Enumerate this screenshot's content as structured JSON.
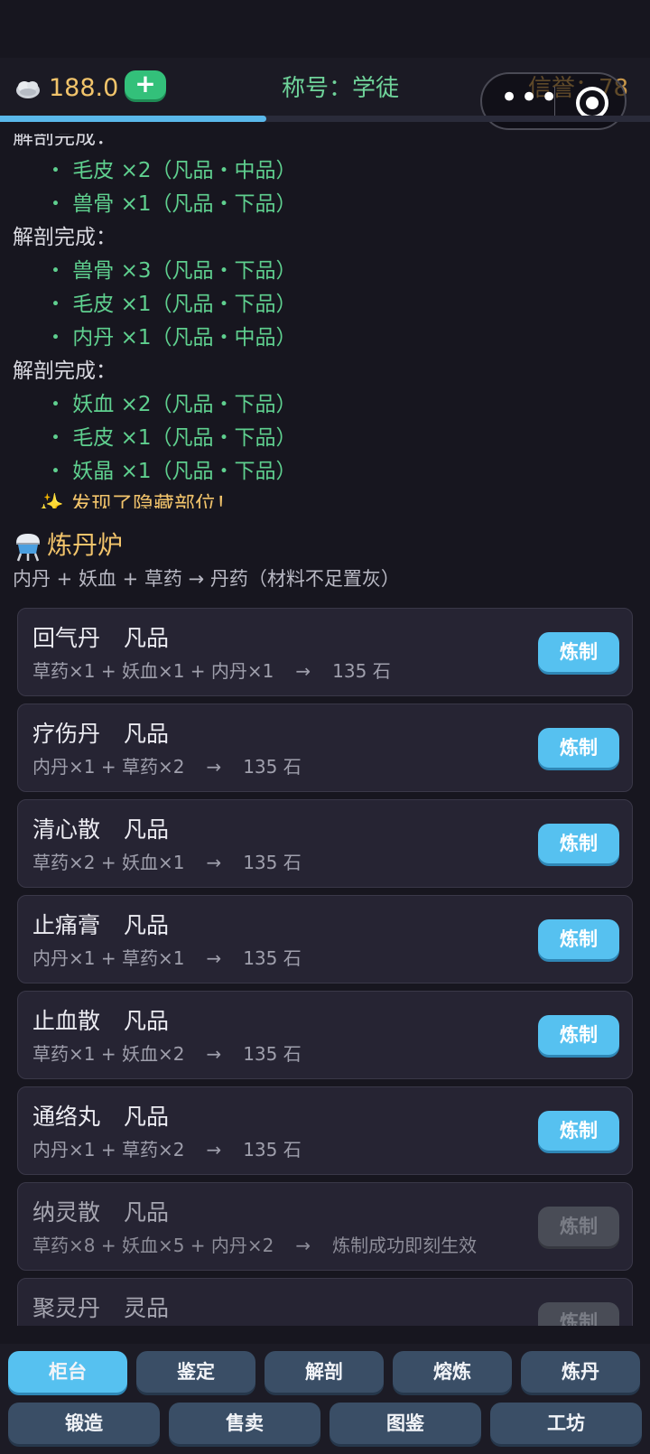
{
  "header": {
    "stone_icon": "spirit-stone-icon",
    "stone_value": "188.0",
    "plus_label": "+",
    "title_line": "称号：学徒",
    "credit_line": "信誉：78",
    "progress": 0.41
  },
  "capsule": {
    "more_label": "•••",
    "close_icon": "target-icon"
  },
  "log": [
    {
      "type": "head",
      "text": "解剖完成："
    },
    {
      "type": "item",
      "text": "・ 毛皮 ×2（凡品・中品）"
    },
    {
      "type": "item",
      "text": "・ 兽骨 ×1（凡品・下品）"
    },
    {
      "type": "head",
      "text": "解剖完成："
    },
    {
      "type": "item",
      "text": "・ 兽骨 ×3（凡品・下品）"
    },
    {
      "type": "item",
      "text": "・ 毛皮 ×1（凡品・下品）"
    },
    {
      "type": "item",
      "text": "・ 内丹 ×1（凡品・中品）"
    },
    {
      "type": "head",
      "text": "解剖完成："
    },
    {
      "type": "item",
      "text": "・ 妖血 ×2（凡品・下品）"
    },
    {
      "type": "item",
      "text": "・ 毛皮 ×1（凡品・下品）"
    },
    {
      "type": "item",
      "text": "・ 妖晶 ×1（凡品・下品）"
    },
    {
      "type": "bonus",
      "text": "✨ 发现了隐藏部位！"
    }
  ],
  "furnace": {
    "icon": "alchemy-flask-icon",
    "title": "炼丹炉",
    "subtitle": "内丹 + 妖血 + 草药 → 丹药（材料不足置灰）",
    "recipes": [
      {
        "name": "回气丹",
        "grade": "凡品",
        "inputs": "草药×1 + 妖血×1 + 内丹×1",
        "arrow": "→",
        "output": "135 石",
        "button": "炼制",
        "enabled": true
      },
      {
        "name": "疗伤丹",
        "grade": "凡品",
        "inputs": "内丹×1 + 草药×2",
        "arrow": "→",
        "output": "135 石",
        "button": "炼制",
        "enabled": true
      },
      {
        "name": "清心散",
        "grade": "凡品",
        "inputs": "草药×2 + 妖血×1",
        "arrow": "→",
        "output": "135 石",
        "button": "炼制",
        "enabled": true
      },
      {
        "name": "止痛膏",
        "grade": "凡品",
        "inputs": "内丹×1 + 草药×1",
        "arrow": "→",
        "output": "135 石",
        "button": "炼制",
        "enabled": true
      },
      {
        "name": "止血散",
        "grade": "凡品",
        "inputs": "草药×1 + 妖血×2",
        "arrow": "→",
        "output": "135 石",
        "button": "炼制",
        "enabled": true
      },
      {
        "name": "通络丸",
        "grade": "凡品",
        "inputs": "内丹×1 + 草药×2",
        "arrow": "→",
        "output": "135 石",
        "button": "炼制",
        "enabled": true
      },
      {
        "name": "纳灵散",
        "grade": "凡品",
        "inputs": "草药×8 + 妖血×5 + 内丹×2",
        "arrow": "→",
        "output": "炼制成功即刻生效",
        "button": "炼制",
        "enabled": false
      },
      {
        "name": "聚灵丹",
        "grade": "灵品",
        "inputs": "",
        "arrow": "",
        "output": "",
        "button": "炼制",
        "enabled": false
      }
    ]
  },
  "nav": {
    "row1": [
      {
        "label": "柜台",
        "active": true
      },
      {
        "label": "鉴定",
        "active": false
      },
      {
        "label": "解剖",
        "active": false
      },
      {
        "label": "熔炼",
        "active": false
      },
      {
        "label": "炼丹",
        "active": false
      }
    ],
    "row2": [
      {
        "label": "锻造",
        "active": false
      },
      {
        "label": "售卖",
        "active": false
      },
      {
        "label": "图鉴",
        "active": false
      },
      {
        "label": "工坊",
        "active": false
      }
    ]
  },
  "colors": {
    "background": "#17161f",
    "accent_blue": "#56c1f0",
    "gold": "#f2c46b",
    "green": "#5fd08f",
    "card": "#262433",
    "nav_button": "#3a4e66",
    "disabled_button": "#494c56"
  }
}
